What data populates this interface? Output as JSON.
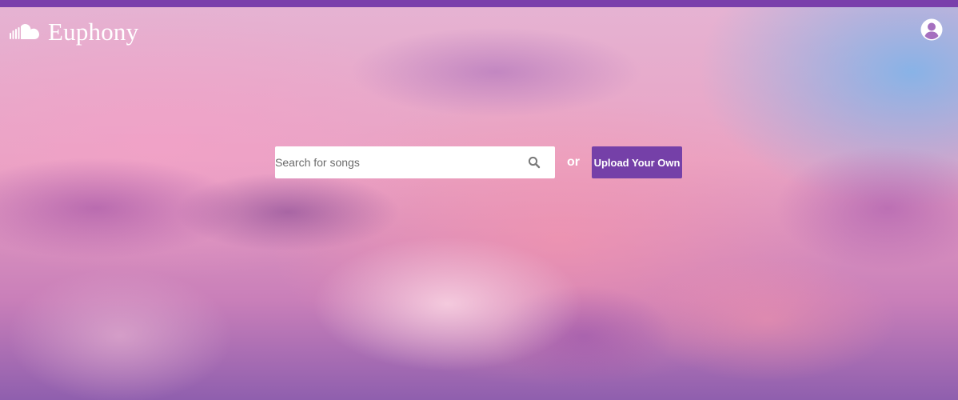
{
  "app": {
    "name": "Euphony",
    "logo_icon": "cloud-icon",
    "accent_color": "#7540a8",
    "top_bar_color": "#7a3fab"
  },
  "header": {
    "profile_icon": "user-account-icon"
  },
  "search": {
    "placeholder": "Search for songs",
    "value": "",
    "icon": "search-icon"
  },
  "divider_text": "or",
  "upload": {
    "label": "Upload Your Own"
  }
}
